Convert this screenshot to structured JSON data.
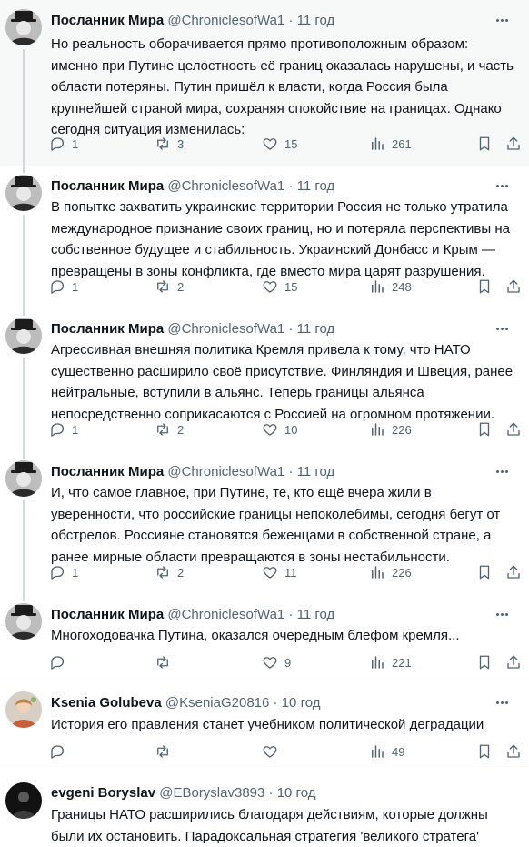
{
  "tweets": [
    {
      "name": "Посланник Мира",
      "handle": "@ChroniclesofWa1",
      "dot": "·",
      "time": "11 год",
      "text": "Но реальность оборачивается прямо противоположным образом: именно при Путине целостность её границ оказалась нарушены, и часть области потеряны. Путин пришёл к власти, когда Россия была крупнейшей страной мира, сохраняя спокойствие на границах. Однако сегодня ситуация изменилась:",
      "replies": "1",
      "retweets": "3",
      "likes": "15",
      "views": "261"
    },
    {
      "name": "Посланник Мира",
      "handle": "@ChroniclesofWa1",
      "dot": "·",
      "time": "11 год",
      "text": "В попытке захватить украинские территории Россия не только утратила международное признание своих границ, но и потеряла перспективы на собственное будущее и стабильность. Украинский Донбасс и Крым — превращены в зоны конфликта, где вместо мира царят разрушения.",
      "replies": "1",
      "retweets": "2",
      "likes": "15",
      "views": "248"
    },
    {
      "name": "Посланник Мира",
      "handle": "@ChroniclesofWa1",
      "dot": "·",
      "time": "11 год",
      "text": "Агрессивная внешняя политика Кремля привела к тому, что НАТО существенно расширило своё присутствие. Финляндия и Швеция, ранее нейтральные, вступили в альянс. Теперь границы альянса непосредственно соприкасаются с Россией на огромном протяжении.",
      "replies": "1",
      "retweets": "2",
      "likes": "10",
      "views": "226"
    },
    {
      "name": "Посланник Мира",
      "handle": "@ChroniclesofWa1",
      "dot": "·",
      "time": "11 год",
      "text": "И, что самое главное, при Путине, те, кто ещё вчера жили в уверенности, что российские границы непоколебимы, сегодня бегут от обстрелов. Россияне становятся беженцами в собственной стране, а ранее мирные области превращаются в зоны нестабильности.",
      "replies": "1",
      "retweets": "2",
      "likes": "11",
      "views": "226"
    },
    {
      "name": "Посланник Мира",
      "handle": "@ChroniclesofWa1",
      "dot": "·",
      "time": "11 год",
      "text": "Многоходовачка Путина, оказался очередным блефом кремля...",
      "replies": "",
      "retweets": "",
      "likes": "9",
      "views": "221"
    },
    {
      "name": "Ksenia Golubeva",
      "handle": "@KseniaG20816",
      "dot": "·",
      "time": "10 год",
      "text": "История его правления станет учебником политической деградации",
      "replies": "",
      "retweets": "",
      "likes": "",
      "views": "49"
    },
    {
      "name": "evgeni Boryslav",
      "handle": "@EBoryslav3893",
      "dot": "·",
      "time": "10 год",
      "text": "Границы НАТО расширились благодаря действиям, которые должны были их остановить. Парадоксальная стратегия 'великого стратега'",
      "replies": "",
      "retweets": "",
      "likes": "",
      "views": ""
    }
  ],
  "icons": {
    "reply": "reply-icon",
    "retweet": "retweet-icon",
    "like": "heart-icon",
    "views": "views-chart-icon",
    "bookmark": "bookmark-icon",
    "share": "share-icon",
    "more": "more-dots-icon"
  },
  "colors": {
    "text": "#0f1419",
    "muted": "#536471",
    "thread_line": "#cfd9de",
    "highlight_bg": "#f7f9f9"
  }
}
